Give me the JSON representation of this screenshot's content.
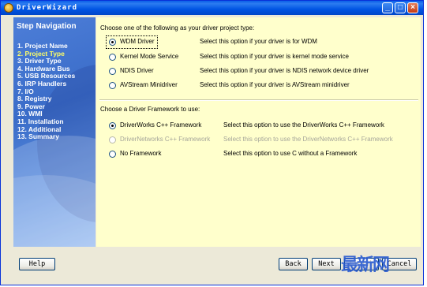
{
  "window": {
    "title": "DriverWizard",
    "minimize_icon": "minimize-icon",
    "maximize_icon": "maximize-icon",
    "close_icon": "close-icon"
  },
  "sidebar": {
    "heading": "Step Navigation",
    "items": [
      {
        "label": "1. Project Name",
        "active": false
      },
      {
        "label": "2. Project Type",
        "active": true
      },
      {
        "label": "3. Driver Type",
        "active": false
      },
      {
        "label": "4. Hardware Bus",
        "active": false
      },
      {
        "label": "5. USB Resources",
        "active": false
      },
      {
        "label": "6. IRP Handlers",
        "active": false
      },
      {
        "label": "7. I/O",
        "active": false
      },
      {
        "label": "8. Registry",
        "active": false
      },
      {
        "label": "9. Power",
        "active": false
      },
      {
        "label": "10. WMI",
        "active": false
      },
      {
        "label": "11. Installation",
        "active": false
      },
      {
        "label": "12. Additional",
        "active": false
      },
      {
        "label": "13. Summary",
        "active": false
      }
    ]
  },
  "project_type": {
    "prompt": "Choose one of the following as your driver project type:",
    "options": [
      {
        "label": "WDM Driver",
        "desc": "Select this option if your driver is for WDM",
        "checked": true
      },
      {
        "label": "Kernel Mode Service",
        "desc": "Select this option if your driver is kernel mode service",
        "checked": false
      },
      {
        "label": "NDIS Driver",
        "desc": "Select this option if your driver is NDIS network device driver",
        "checked": false
      },
      {
        "label": "AVStream Minidriver",
        "desc": "Select this option if your driver is AVStream minidriver",
        "checked": false
      }
    ]
  },
  "framework": {
    "prompt": "Choose a Driver Framework to use:",
    "options": [
      {
        "label": "DriverWorks C++ Framework",
        "desc": "Select this option to use the DriverWorks C++ Framework",
        "checked": true,
        "disabled": false
      },
      {
        "label": "DriverNetworks C++ Framework",
        "desc": "Select this option to use the DriverNetworks C++ Framework",
        "checked": false,
        "disabled": true
      },
      {
        "label": "No Framework",
        "desc": "Select this option to use C without a Framework",
        "checked": false,
        "disabled": false
      }
    ]
  },
  "buttons": {
    "help": "Help",
    "back": "Back",
    "next": "Next",
    "finish": "Finish",
    "cancel": "Cancel"
  },
  "watermark": "最新网"
}
